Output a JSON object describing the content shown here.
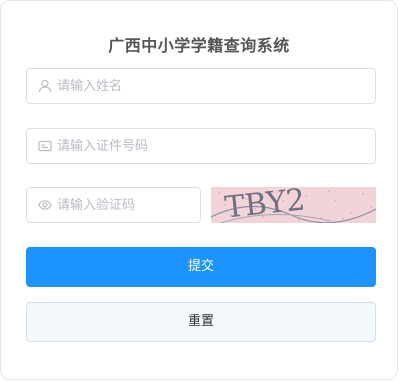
{
  "form": {
    "title": "广西中小学学籍查询系统",
    "name_placeholder": "请输入姓名",
    "id_placeholder": "请输入证件号码",
    "code_placeholder": "请输入验证码",
    "captcha_text": "TBY2",
    "submit_label": "提交",
    "reset_label": "重置"
  },
  "colors": {
    "primary": "#1c93fe",
    "reset_bg": "#f4f9fe",
    "captcha_bg": "#f1d3d8"
  },
  "icons": {
    "name": "user-icon",
    "id": "id-card-icon",
    "code": "eye-icon"
  }
}
